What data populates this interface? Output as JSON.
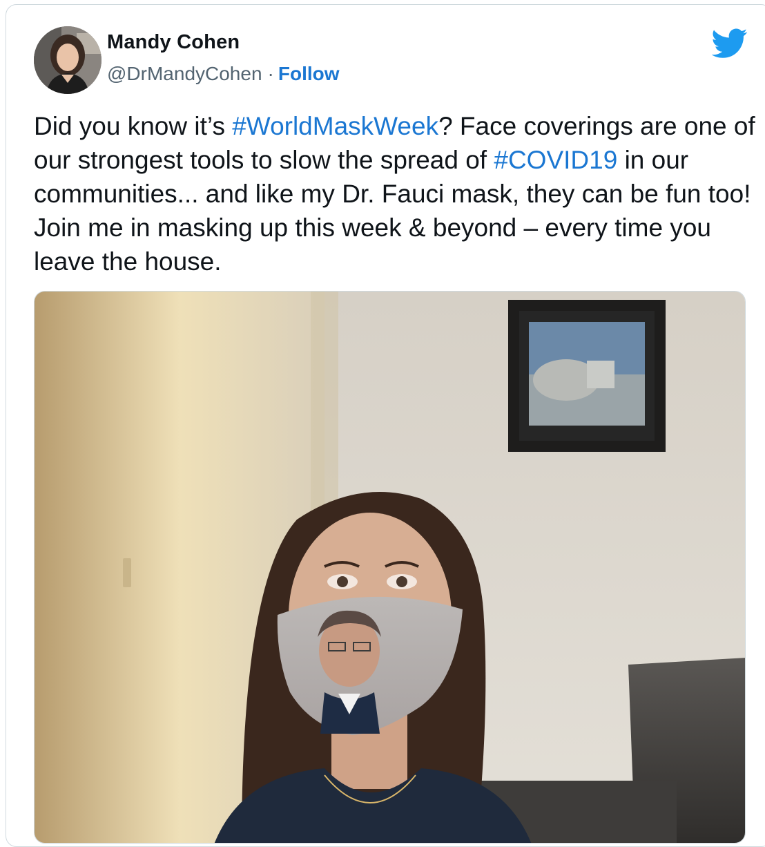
{
  "author": {
    "name": "Mandy Cohen",
    "handle": "@DrMandyCohen",
    "separator": "·",
    "follow_label": "Follow",
    "avatar_icon": "profile-photo",
    "verified_icon": "twitter-bird-icon"
  },
  "tweet": {
    "text_1": "Did you know it’s ",
    "hashtag_1": "#WorldMaskWeek",
    "text_2": "? Face coverings are one of our strongest tools to slow the spread of ",
    "hashtag_2": "#COVID19",
    "text_3": " in our communities... and like my Dr. Fauci mask, they can be fun too! Join me in masking up this week & beyond – every time you leave the house."
  },
  "media": {
    "type": "photo"
  },
  "colors": {
    "link": "#1b77d2",
    "brand": "#1d9bf0",
    "text": "#0f1419",
    "secondary": "#536471",
    "border": "#cfd9de"
  }
}
